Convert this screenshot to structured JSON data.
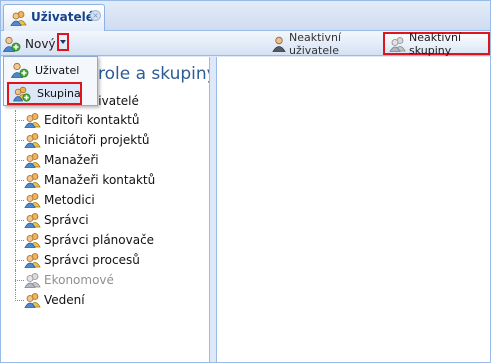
{
  "tab": {
    "title": "Uživatelé",
    "close_glyph": "×",
    "icon": "users-icon"
  },
  "toolbar": {
    "new_label": "Nový",
    "inactive_users_label": "Neaktivní uživatele",
    "inactive_groups_label": "Neaktivní skupiny"
  },
  "menu": {
    "items": [
      {
        "label": "Uživatel",
        "icon": "user-add-icon"
      },
      {
        "label": "Skupina",
        "icon": "group-add-icon"
      }
    ]
  },
  "tree": {
    "heading": "role a skupiny",
    "root_label_partial": "živatelé",
    "items": [
      {
        "label": "Editoři kontaktů",
        "icon": "group-icon",
        "disabled": false
      },
      {
        "label": "Iniciátoři projektů",
        "icon": "group-icon",
        "disabled": false
      },
      {
        "label": "Manažeři",
        "icon": "group-icon",
        "disabled": false
      },
      {
        "label": "Manažeři kontaktů",
        "icon": "group-icon",
        "disabled": false
      },
      {
        "label": "Metodici",
        "icon": "group-icon",
        "disabled": false
      },
      {
        "label": "Správci",
        "icon": "group-icon",
        "disabled": false
      },
      {
        "label": "Správci plánovače",
        "icon": "group-icon",
        "disabled": false
      },
      {
        "label": "Správci procesů",
        "icon": "group-icon",
        "disabled": false
      },
      {
        "label": "Ekonomové",
        "icon": "group-inactive-icon",
        "disabled": true
      },
      {
        "label": "Vedení",
        "icon": "group-icon",
        "disabled": false
      }
    ]
  },
  "colors": {
    "highlight_border": "#e0141b",
    "accent": "#15428b",
    "panel_border": "#99bbe8"
  }
}
